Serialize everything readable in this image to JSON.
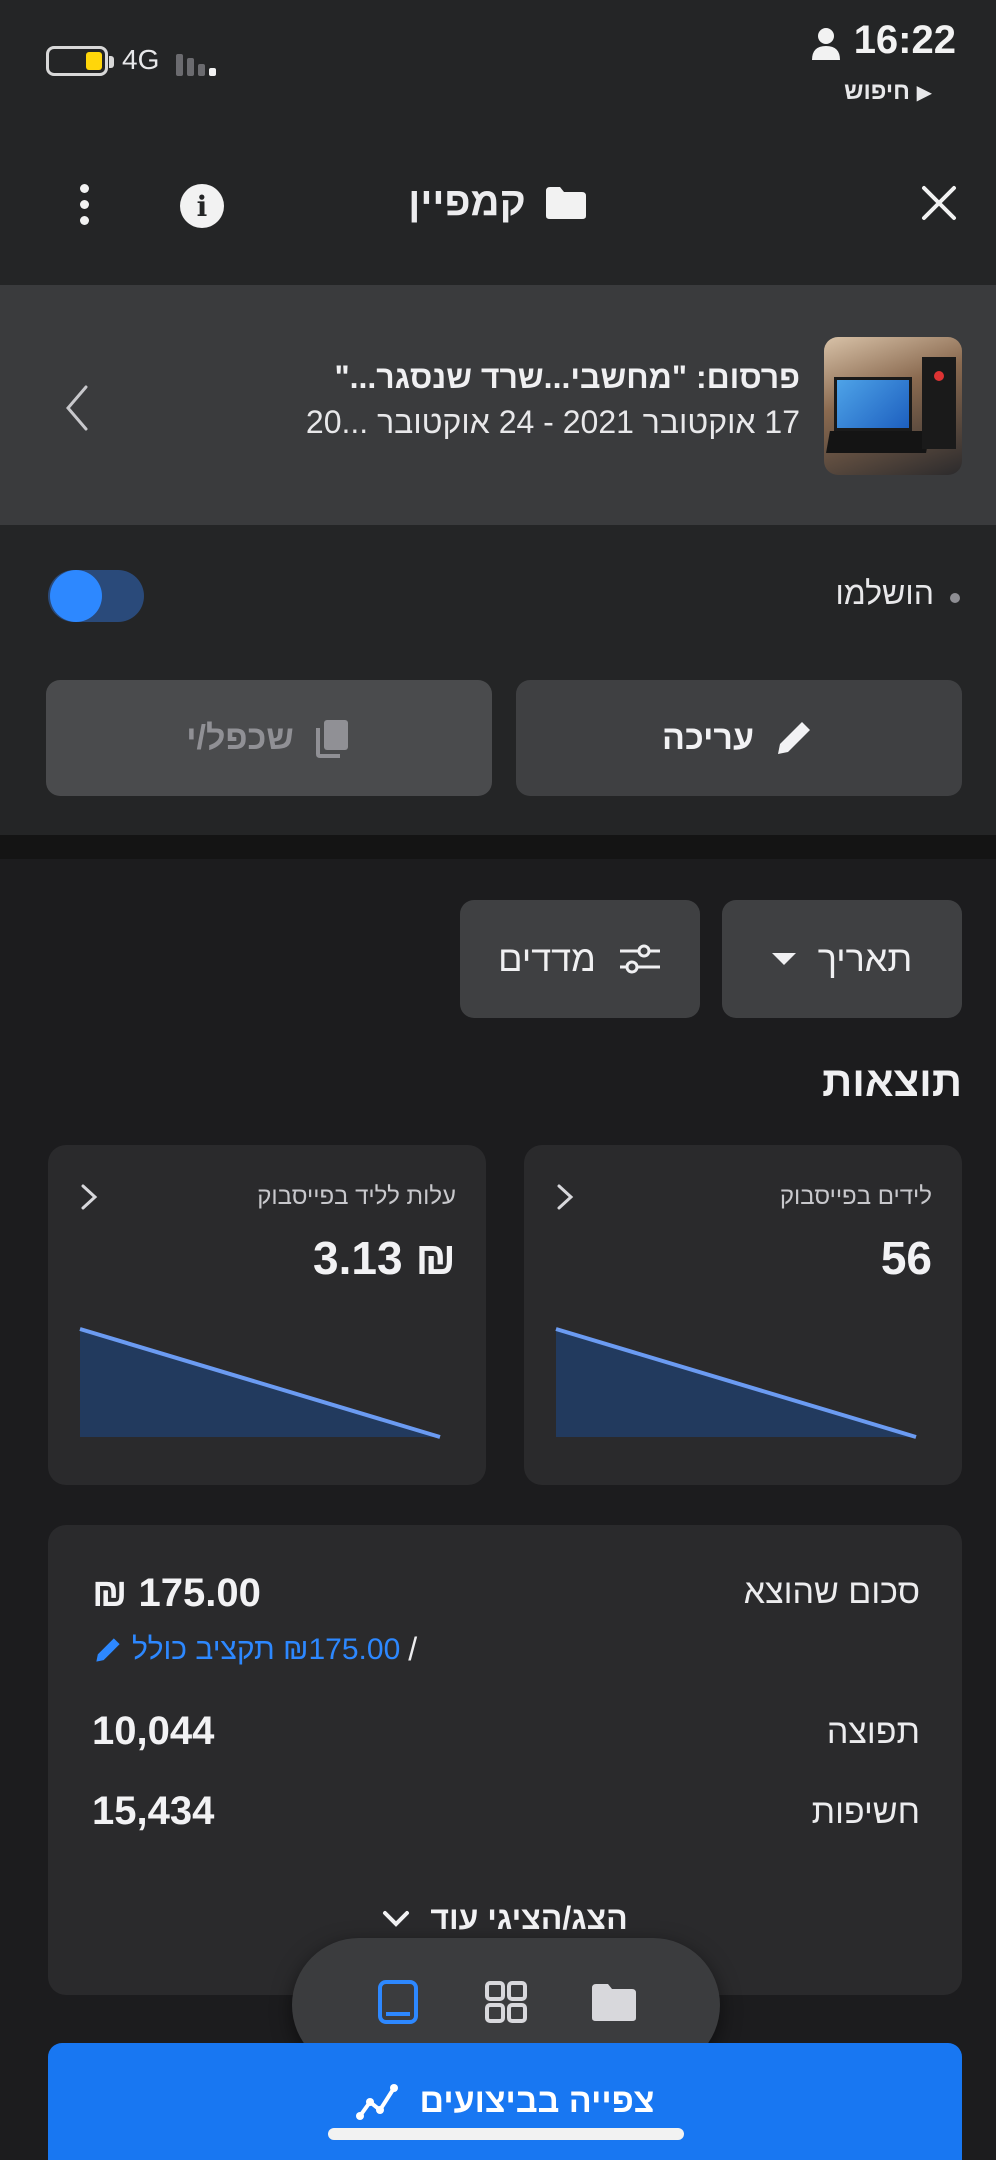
{
  "status_bar": {
    "time": "16:22",
    "network": "4G",
    "back_app": "חיפוש"
  },
  "header": {
    "title": "קמפיין"
  },
  "ad": {
    "title": "פרסום: \"מחשבי...שרד שנסגר...\"",
    "dates": "17 אוקטובר 2021 - 24 אוקטובר ...20"
  },
  "status": {
    "label": "הושלמו",
    "toggle_on": true
  },
  "actions": {
    "edit_label": "עריכה",
    "duplicate_label": "שכפל/י"
  },
  "filters": {
    "date_label": "תאריך",
    "metrics_label": "מדדים"
  },
  "results": {
    "title": "תוצאות",
    "cards": [
      {
        "label": "לידים בפייסבוק",
        "value": "56"
      },
      {
        "label": "עלות לליד בפייסבוק",
        "value": "₪ 3.13"
      }
    ]
  },
  "chart_data": [
    {
      "type": "area",
      "values": [
        1.0,
        0.0
      ],
      "color": "#6b9bf2"
    },
    {
      "type": "area",
      "values": [
        1.0,
        0.0
      ],
      "color": "#6b9bf2"
    }
  ],
  "budget": {
    "spent_label": "סכום שהוצא",
    "spent_value": "₪ 175.00",
    "total_budget": "₪175.00 תקציב כולל",
    "slash": "/",
    "reach_label": "תפוצה",
    "reach_value": "10,044",
    "impressions_label": "חשיפות",
    "impressions_value": "15,434",
    "show_more": "הצג/הציגי עוד"
  },
  "bottom": {
    "view_performance": "צפייה בביצועים"
  },
  "colors": {
    "accent": "#1877f2",
    "link": "#2d88ff",
    "background": "#1c1c1e"
  }
}
